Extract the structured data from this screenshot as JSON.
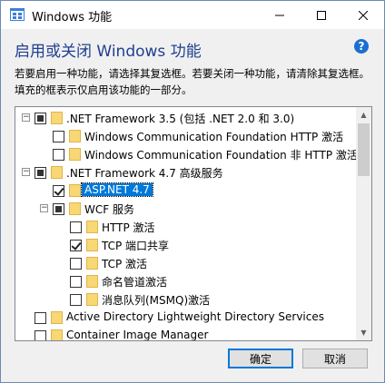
{
  "window": {
    "title": "Windows 功能"
  },
  "header": {
    "heading": "启用或关闭 Windows 功能",
    "description": "若要启用一种功能，请选择其复选框。若要关闭一种功能，请清除其复选框。填充的框表示仅启用该功能的一部分。"
  },
  "tree": {
    "items": [
      {
        "label": ".NET Framework 3.5 (包括 .NET 2.0 和 3.0)",
        "state": "partial",
        "expanded": true
      },
      {
        "label": "Windows Communication Foundation HTTP 激活",
        "state": "unchecked"
      },
      {
        "label": "Windows Communication Foundation 非 HTTP 激活",
        "state": "unchecked"
      },
      {
        "label": ".NET Framework 4.7 高级服务",
        "state": "partial",
        "expanded": true
      },
      {
        "label": "ASP.NET 4.7",
        "state": "checked",
        "selected": true
      },
      {
        "label": "WCF 服务",
        "state": "partial",
        "expanded": true
      },
      {
        "label": "HTTP 激活",
        "state": "unchecked"
      },
      {
        "label": "TCP 端口共享",
        "state": "checked"
      },
      {
        "label": "TCP 激活",
        "state": "unchecked"
      },
      {
        "label": "命名管道激活",
        "state": "unchecked"
      },
      {
        "label": "消息队列(MSMQ)激活",
        "state": "unchecked"
      },
      {
        "label": "Active Directory Lightweight Directory Services",
        "state": "unchecked"
      },
      {
        "label": "Container Image Manager",
        "state": "unchecked"
      }
    ]
  },
  "buttons": {
    "ok": "确定",
    "cancel": "取消"
  },
  "icons": {
    "app": "windows-features-icon",
    "help": "help-icon",
    "folder": "folder-icon"
  },
  "colors": {
    "accent": "#0078d7",
    "heading": "#1f3f8f",
    "folder": "#f8d775"
  }
}
